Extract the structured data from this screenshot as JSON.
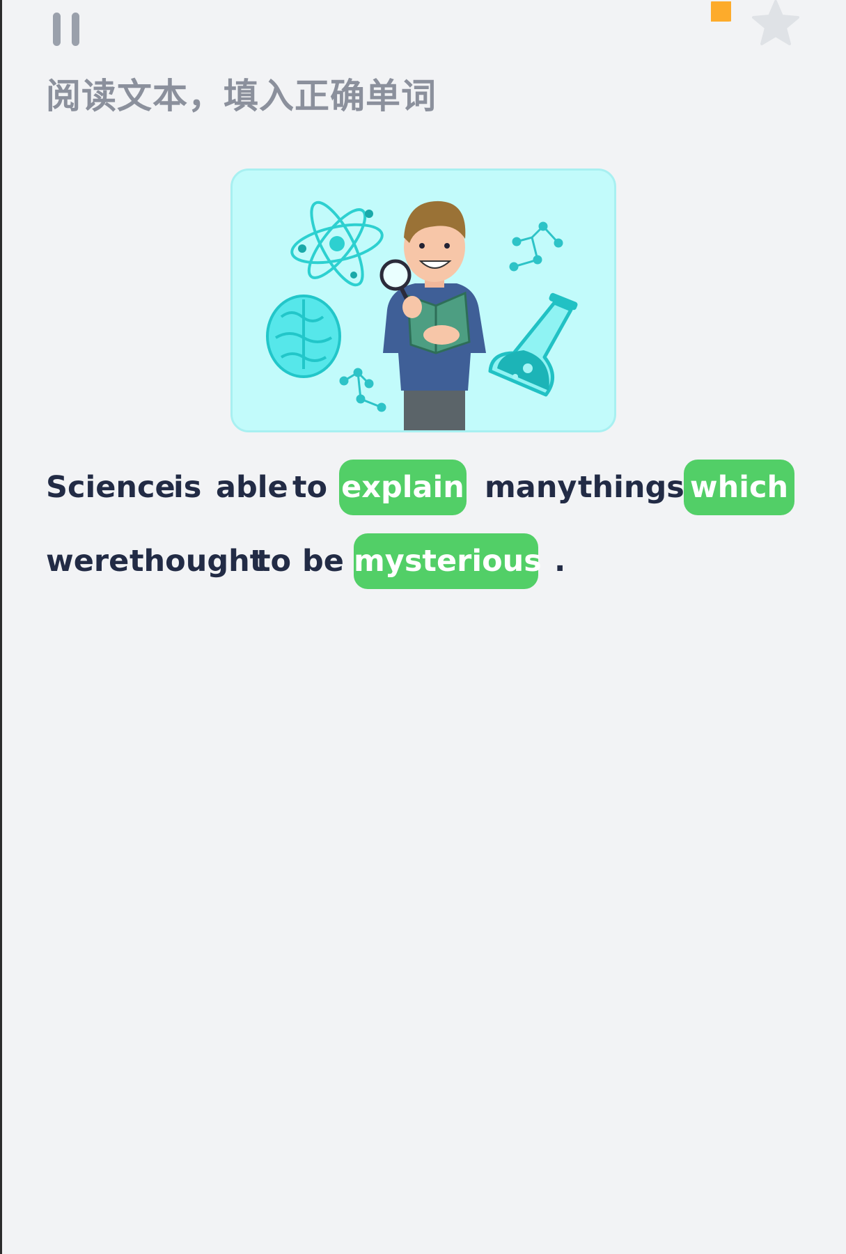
{
  "header": {
    "pause_icon": "pause-icon",
    "timer_icon": "timer-pie-icon",
    "star_icon": "star-icon"
  },
  "instruction": "阅读文本，填入正确单词",
  "illustration": {
    "subject": "scientist with magnifying glass, book, atom, brain, flask"
  },
  "sentence": {
    "line1": [
      "Science",
      "is",
      "able",
      "to",
      "explain",
      "many",
      "things",
      "which"
    ],
    "line2": [
      "were",
      "thought",
      "to",
      "be",
      "mysterious",
      "."
    ],
    "answers": [
      "explain",
      "which",
      "mysterious"
    ]
  },
  "colors": {
    "background": "#f2f3f5",
    "answer_chip": "#52cf67",
    "text": "#222b45",
    "instruction": "#8b909c",
    "timer": "#fdab2b",
    "star": "#dfe2e6"
  }
}
